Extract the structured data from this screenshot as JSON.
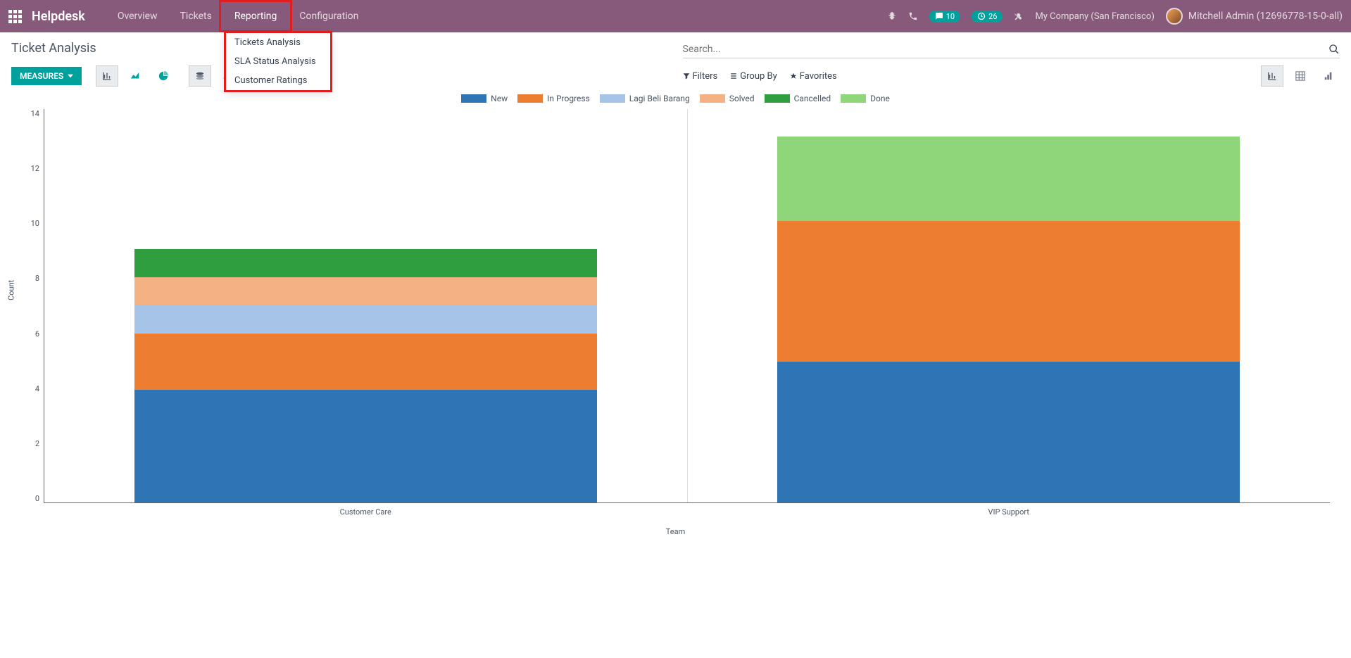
{
  "topnav": {
    "brand": "Helpdesk",
    "items": [
      "Overview",
      "Tickets",
      "Reporting",
      "Configuration"
    ],
    "active_index": 2,
    "company": "My Company (San Francisco)",
    "user": "Mitchell Admin (12696778-15-0-all)",
    "msg_badge": "10",
    "clock_badge": "26"
  },
  "dropdown": {
    "items": [
      "Tickets Analysis",
      "SLA Status Analysis",
      "Customer Ratings"
    ]
  },
  "page": {
    "title": "Ticket Analysis",
    "measures_label": "MEASURES"
  },
  "search": {
    "placeholder": "Search...",
    "filters": "Filters",
    "groupby": "Group By",
    "favorites": "Favorites"
  },
  "chart_data": {
    "type": "bar",
    "xlabel": "Team",
    "ylabel": "Count",
    "ylim": [
      0,
      14
    ],
    "yticks": [
      0,
      2,
      4,
      6,
      8,
      10,
      12,
      14
    ],
    "categories": [
      "Customer Care",
      "VIP Support"
    ],
    "series": [
      {
        "name": "New",
        "color": "#2E75B6",
        "values": [
          4,
          5
        ]
      },
      {
        "name": "In Progress",
        "color": "#ED7D31",
        "values": [
          2,
          5
        ]
      },
      {
        "name": "Lagi Beli Barang",
        "color": "#A6C4E8",
        "values": [
          1,
          0
        ]
      },
      {
        "name": "Solved",
        "color": "#F4B183",
        "values": [
          1,
          0
        ]
      },
      {
        "name": "Cancelled",
        "color": "#2E9E3F",
        "values": [
          1,
          0
        ]
      },
      {
        "name": "Done",
        "color": "#8FD67A",
        "values": [
          0,
          3
        ]
      }
    ]
  }
}
